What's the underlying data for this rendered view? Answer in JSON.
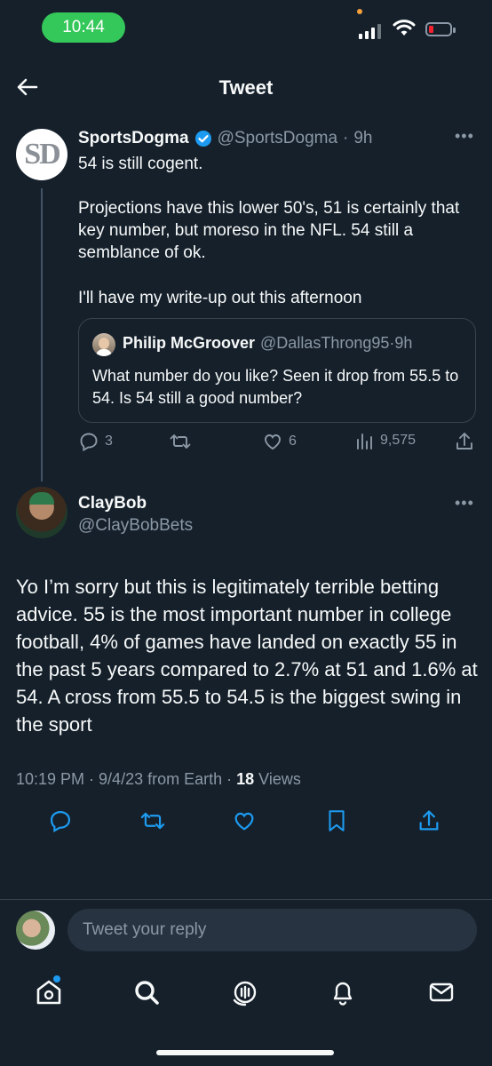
{
  "status_bar": {
    "time": "10:44",
    "colors": {
      "time_pill": "#34c759",
      "battery_low": "#f4212e"
    }
  },
  "header": {
    "title": "Tweet",
    "back_icon": "arrow-left-icon"
  },
  "original_tweet": {
    "avatar_text": "SD",
    "display_name": "SportsDogma",
    "handle": "@SportsDogma",
    "separator": "·",
    "time_ago": "9h",
    "verified": true,
    "line1": "54 is still cogent.",
    "paragraph2": "Projections have this lower 50's, 51 is certainly that key number, but moreso in the NFL. 54 still a semblance of ok.",
    "paragraph3": "I'll have my write-up out this afternoon",
    "quote": {
      "display_name": "Philip McGroover",
      "handle": "@DallasThrong95",
      "separator": "·",
      "time_ago": "9h",
      "text": "What number do you like? Seen it drop from 55.5 to 54. Is 54 still a good number?"
    },
    "stats": {
      "replies": "3",
      "likes": "6",
      "views": "9,575"
    }
  },
  "main_tweet": {
    "display_name": "ClayBob",
    "handle": "@ClayBobBets",
    "text": "Yo I’m sorry but this is legitimately terrible betting advice. 55 is the most important number in college football, 4% of games have landed on exactly 55 in the past 5 years compared to 2.7% at 51 and 1.6% at 54. A cross from 55.5 to 54.5 is the biggest swing in the sport",
    "meta_time": "10:19 PM · 9/4/23 from Earth · ",
    "meta_views_count": "18",
    "meta_views_label": " Views"
  },
  "reply": {
    "placeholder": "Tweet your reply"
  },
  "tabbar": {
    "items": [
      "home-icon",
      "search-icon",
      "spaces-icon",
      "notifications-icon",
      "messages-icon"
    ],
    "accent": "#1d9bf0"
  }
}
